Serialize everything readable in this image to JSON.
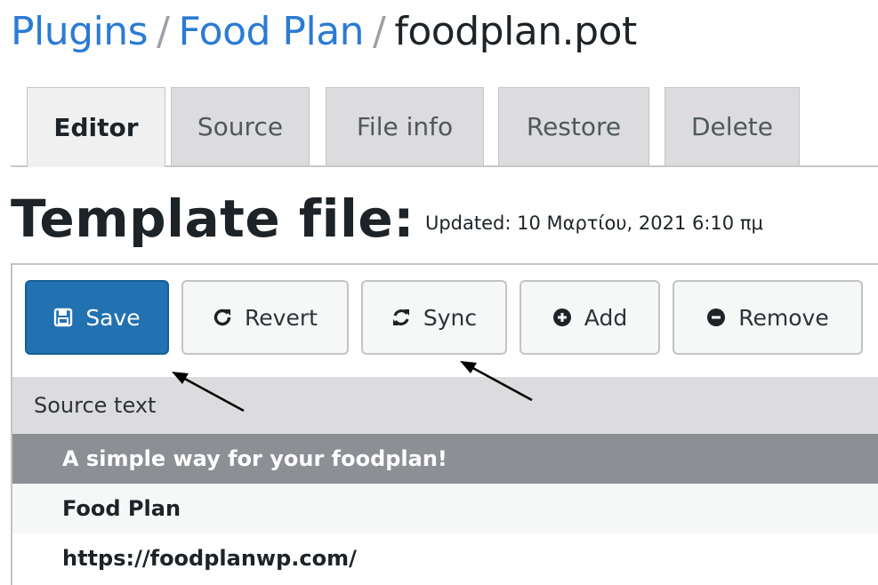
{
  "breadcrumb": {
    "items": [
      "Plugins",
      "Food Plan"
    ],
    "separator": "/",
    "current": "foodplan.pot"
  },
  "tabs": [
    {
      "label": "Editor",
      "active": true
    },
    {
      "label": "Source",
      "active": false
    },
    {
      "label": "File info",
      "active": false
    },
    {
      "label": "Restore",
      "active": false
    },
    {
      "label": "Delete",
      "active": false
    }
  ],
  "section": {
    "title": "Template file:",
    "updated": "Updated: 10 Μαρτίου, 2021 6:10 πμ"
  },
  "toolbar": {
    "save_label": "Save",
    "revert_label": "Revert",
    "sync_label": "Sync",
    "add_label": "Add",
    "remove_label": "Remove"
  },
  "icons": {
    "save": "floppy-disk-icon",
    "revert": "revert-icon",
    "sync": "sync-icon",
    "add": "plus-circle-icon",
    "remove": "minus-circle-icon"
  },
  "table": {
    "header": "Source text",
    "rows": [
      {
        "text": "A simple way for your foodplan!",
        "selected": true
      },
      {
        "text": "Food Plan",
        "selected": false
      },
      {
        "text": "https://foodplanwp.com/",
        "selected": false
      }
    ]
  },
  "colors": {
    "link": "#2c7bd3",
    "primary_button": "#2271b1",
    "selected_row": "#8c8f94"
  }
}
